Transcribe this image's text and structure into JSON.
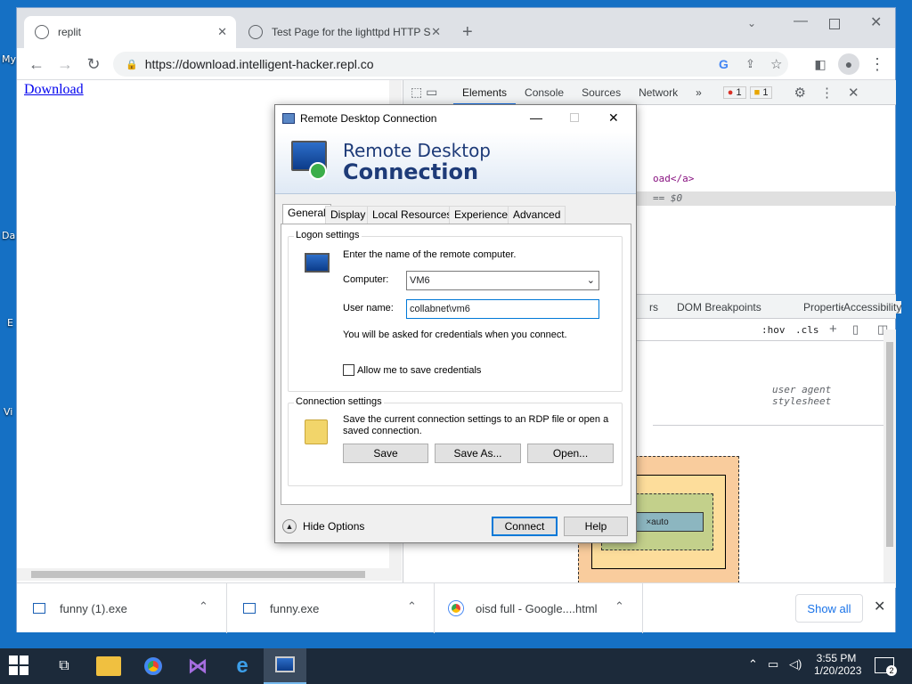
{
  "desktop": {
    "labels": [
      "My",
      "Da",
      "E",
      "Vi"
    ]
  },
  "browser": {
    "tabs": [
      {
        "title": "replit"
      },
      {
        "title": "Test Page for the lighttpd HTTP S"
      }
    ],
    "new_tab": "+",
    "url": "https://download.intelligent-hacker.repl.co"
  },
  "page": {
    "link": "Download"
  },
  "devtools": {
    "tabs": [
      "Elements",
      "Console",
      "Sources",
      "Network",
      "»"
    ],
    "errors": "1",
    "warnings": "1",
    "code1": "oad</a>",
    "code2": "== $0",
    "subtabs": [
      "rs",
      "DOM Breakpoints",
      "Properties",
      "Accessibility"
    ],
    "hov": ":hov",
    "cls": ".cls",
    "ua": "user agent stylesheet",
    "box_content": "×auto",
    "box_dash": "–"
  },
  "rdp": {
    "title": "Remote Desktop Connection",
    "banner_line1": "Remote Desktop",
    "banner_line2": "Connection",
    "tabs": [
      "General",
      "Display",
      "Local Resources",
      "Experience",
      "Advanced"
    ],
    "logon": {
      "label": "Logon settings",
      "instruction": "Enter the name of the remote computer.",
      "computer_label": "Computer:",
      "computer_value": "VM6",
      "user_label": "User name:",
      "user_value": "collabnet\\vm6",
      "cred_note": "You will be asked for credentials when you connect.",
      "allow_save": "Allow me to save credentials",
      "allow_checked": false
    },
    "conn": {
      "label": "Connection settings",
      "text": "Save the current connection settings to an RDP file or open a saved connection.",
      "save": "Save",
      "save_as": "Save As...",
      "open": "Open..."
    },
    "hide_options": "Hide Options",
    "connect": "Connect",
    "help": "Help"
  },
  "downloads": {
    "items": [
      {
        "name": "funny (1).exe"
      },
      {
        "name": "funny.exe"
      },
      {
        "name": "oisd full - Google....html"
      }
    ],
    "show_all": "Show all"
  },
  "taskbar": {
    "time": "3:55 PM",
    "date": "1/20/2023",
    "notif_count": "2"
  }
}
